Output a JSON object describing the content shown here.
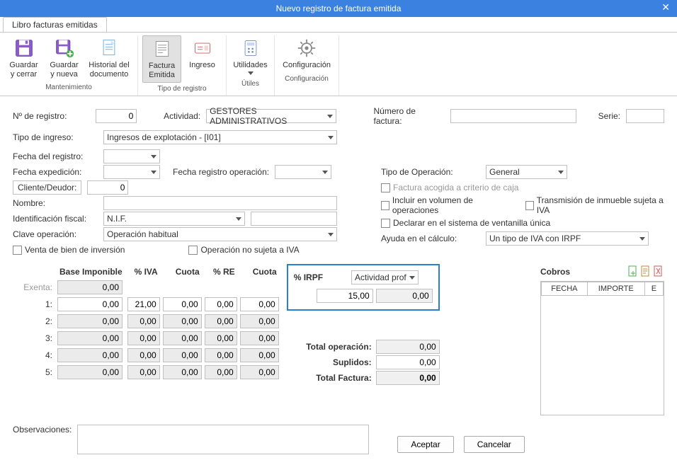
{
  "window": {
    "title": "Nuevo registro de factura emitida",
    "close": "✕"
  },
  "tab": "Libro facturas emitidas",
  "ribbon": {
    "save_close": "Guardar\ny cerrar",
    "save_new": "Guardar\ny nueva",
    "hist": "Historial del\ndocumento",
    "factura": "Factura\nEmitida",
    "ingreso": "Ingreso",
    "util": "Utilidades",
    "config": "Configuración",
    "grp_mant": "Mantenimiento",
    "grp_tipo": "Tipo de registro",
    "grp_util": "Útiles",
    "grp_conf": "Configuración"
  },
  "labels": {
    "nreg": "Nº de registro:",
    "actividad": "Actividad:",
    "numfact": "Número de factura:",
    "serie": "Serie:",
    "tipo_ingreso": "Tipo de ingreso:",
    "fecha_reg": "Fecha del registro:",
    "fecha_exp": "Fecha expedición:",
    "fecha_reg_op": "Fecha registro operación:",
    "cliente": "Cliente/Deudor:",
    "nombre": "Nombre:",
    "idfiscal": "Identificación fiscal:",
    "clave": "Clave operación:",
    "tipo_op": "Tipo de Operación:",
    "ayuda": "Ayuda en el cálculo:",
    "irpf": "% IRPF",
    "cobros": "Cobros",
    "observ": "Observaciones:",
    "total_op": "Total operación:",
    "suplidos": "Suplidos:",
    "total_fact": "Total Factura:"
  },
  "values": {
    "nreg": "0",
    "actividad": "GESTORES ADMINISTRATIVOS",
    "tipo_ingreso": "Ingresos de explotación - [I01]",
    "cliente": "0",
    "idfiscal": "N.I.F.",
    "clave": "Operación habitual",
    "tipo_op": "General",
    "ayuda": "Un tipo de IVA con IRPF",
    "irpf_val": "15,00",
    "irpf_amt": "0,00",
    "irpf_activ": "Actividad prof",
    "total_op": "0,00",
    "suplidos": "0,00",
    "total_fact": "0,00"
  },
  "checks": {
    "venta_bien": "Venta de bien de inversión",
    "op_no_sujeta": "Operación no sujeta a IVA",
    "fact_criterio": "Factura acogida a criterio de caja",
    "incluir_vol": "Incluir en  volumen de operaciones",
    "trans_inmueble": "Transmisión de inmueble sujeta a IVA",
    "declarar_vent": "Declarar en el sistema de ventanilla única"
  },
  "grid": {
    "headers": [
      "",
      "Base Imponible",
      "% IVA",
      "Cuota",
      "% RE",
      "Cuota"
    ],
    "rows": [
      {
        "l": "Exenta:",
        "base": "0,00",
        "iva": "",
        "cuota": "",
        "re": "",
        "cuota2": "",
        "ro": true
      },
      {
        "l": "1:",
        "base": "0,00",
        "iva": "21,00",
        "cuota": "0,00",
        "re": "0,00",
        "cuota2": "0,00",
        "ro": false
      },
      {
        "l": "2:",
        "base": "0,00",
        "iva": "0,00",
        "cuota": "0,00",
        "re": "0,00",
        "cuota2": "0,00",
        "ro": true
      },
      {
        "l": "3:",
        "base": "0,00",
        "iva": "0,00",
        "cuota": "0,00",
        "re": "0,00",
        "cuota2": "0,00",
        "ro": true
      },
      {
        "l": "4:",
        "base": "0,00",
        "iva": "0,00",
        "cuota": "0,00",
        "re": "0,00",
        "cuota2": "0,00",
        "ro": true
      },
      {
        "l": "5:",
        "base": "0,00",
        "iva": "0,00",
        "cuota": "0,00",
        "re": "0,00",
        "cuota2": "0,00",
        "ro": true
      }
    ]
  },
  "cobros_cols": {
    "fecha": "FECHA",
    "importe": "IMPORTE",
    "e": "E"
  },
  "actions": {
    "aceptar": "Aceptar",
    "cancelar": "Cancelar"
  }
}
